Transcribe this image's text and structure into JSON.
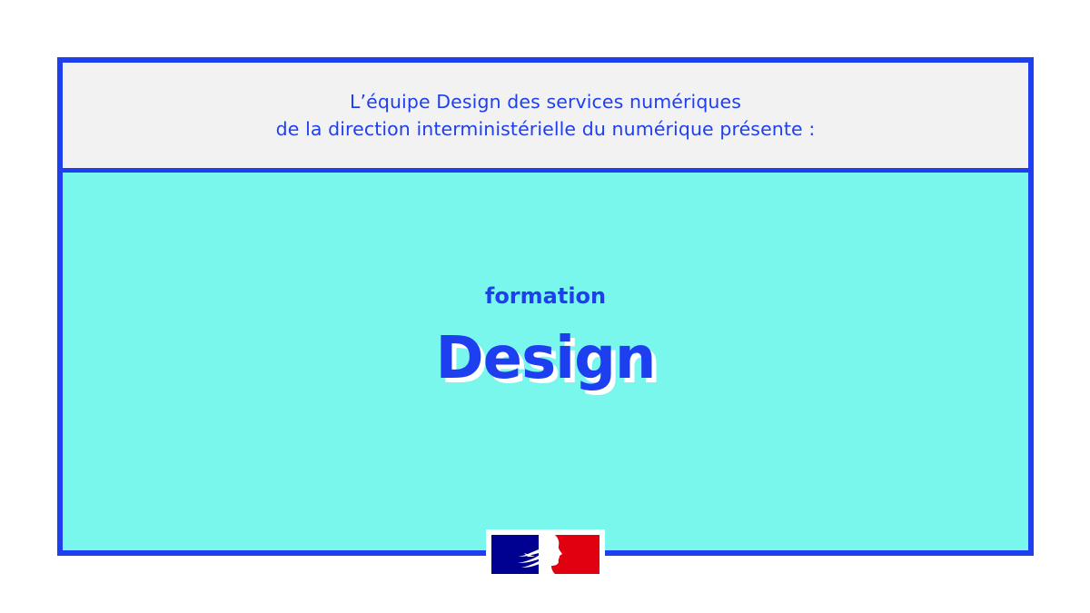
{
  "header": {
    "line1": "L’équipe Design des services numériques",
    "line2": "de la direction interministérielle du numérique présente :"
  },
  "main": {
    "kicker": "formation",
    "title": "Design"
  },
  "logo": {
    "icon": "marianne-logo-icon",
    "colors": {
      "blue": "#000091",
      "white": "#ffffff",
      "red": "#e1000f"
    }
  },
  "colors": {
    "accent": "#1e3ff0",
    "background": "#7af7ec",
    "header_background": "#f2f2f2"
  }
}
